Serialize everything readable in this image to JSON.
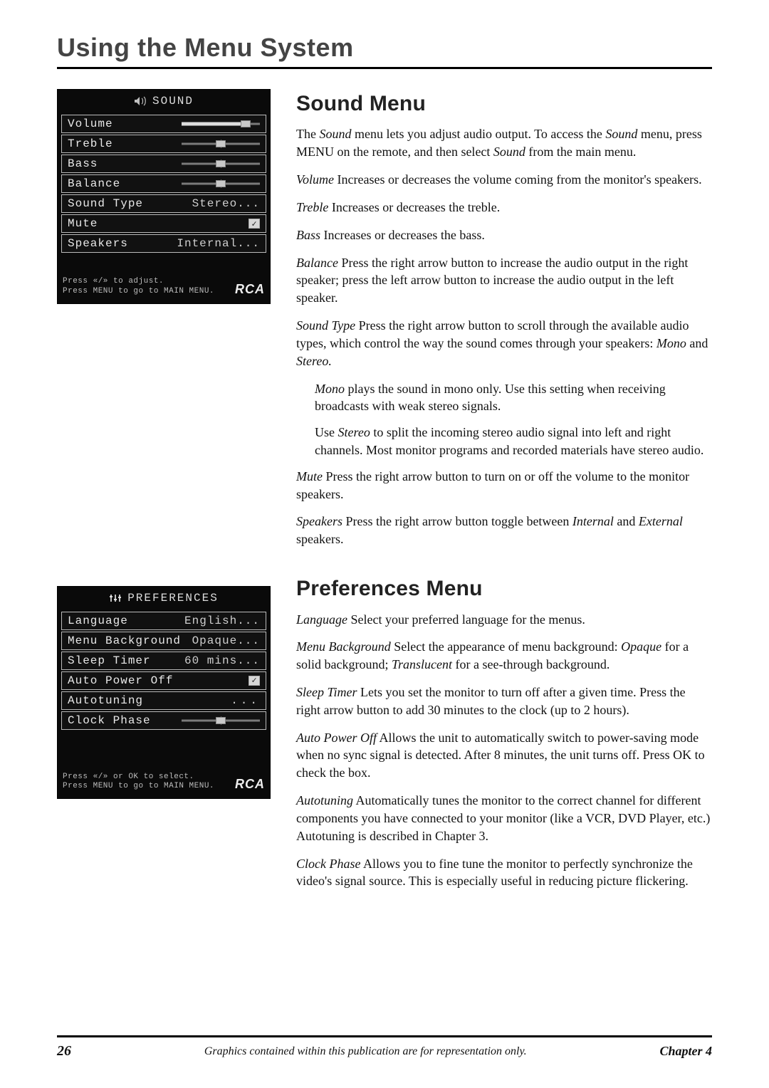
{
  "chapter_title": "Using the Menu System",
  "footer": {
    "page": "26",
    "center": "Graphics contained within this publication are for representation only.",
    "right": "Chapter 4"
  },
  "screens": {
    "sound": {
      "header": "SOUND",
      "items": {
        "volume_label": "Volume",
        "treble_label": "Treble",
        "bass_label": "Bass",
        "balance_label": "Balance",
        "sound_type_label": "Sound Type",
        "sound_type_value": "Stereo...",
        "mute_label": "Mute",
        "mute_checked": "✓",
        "speakers_label": "Speakers",
        "speakers_value": "Internal..."
      },
      "slider": {
        "volume_pct": 82,
        "treble_pct": 50,
        "bass_pct": 50,
        "balance_pct": 50,
        "clock_phase_pct": 50
      },
      "footer": "Press «/» to adjust.\nPress MENU to go to MAIN MENU.",
      "brand": "RCA"
    },
    "prefs": {
      "header": "PREFERENCES",
      "items": {
        "language_label": "Language",
        "language_value": "English...",
        "menu_bg_label": "Menu Background",
        "menu_bg_value": "Opaque...",
        "sleep_label": "Sleep Timer",
        "sleep_value": "60 mins...",
        "apo_label": "Auto Power Off",
        "apo_checked": "✓",
        "autotune_label": "Autotuning",
        "autotune_value": "...",
        "clock_label": "Clock Phase"
      },
      "footer": "Press «/» or OK to select.\nPress MENU to go to MAIN MENU.",
      "brand": "RCA"
    }
  },
  "sound_section": {
    "title": "Sound Menu",
    "intro_1": "The ",
    "intro_em1": "Sound",
    "intro_2": " menu lets you adjust audio output. To access the ",
    "intro_em2": "Sound",
    "intro_3": " menu, press MENU on the remote, and then select ",
    "intro_em3": "Sound",
    "intro_4": " from the main menu.",
    "volume_term": "Volume",
    "volume_desc": "   Increases or decreases the volume coming from the monitor's speakers.",
    "treble_term": "Treble",
    "treble_desc": "  Increases or decreases the treble.",
    "bass_term": "Bass",
    "bass_desc": "  Increases or decreases the bass.",
    "balance_term": "Balance",
    "balance_desc": "  Press the right arrow button to increase the audio output in the right speaker; press the left arrow button to increase the audio output in the left speaker.",
    "stype_term": "Sound Type",
    "stype_desc_a": "   Press the right arrow button to scroll through the available audio types, which control the way the sound comes through your speakers: ",
    "stype_em1": "Mono",
    "stype_and": " and ",
    "stype_em2": "Stereo.",
    "mono_em": "Mono",
    "mono_desc": " plays the sound in mono only. Use this setting when receiving broadcasts with weak stereo signals.",
    "stereo_pre": "Use ",
    "stereo_em": "Stereo",
    "stereo_desc": " to split the incoming stereo audio signal into left and right channels. Most monitor programs and recorded materials have stereo audio.",
    "mute_term": "Mute",
    "mute_desc": "   Press the right arrow button to turn on or off the volume to the monitor speakers.",
    "speakers_term": "Speakers",
    "speakers_desc_a": "   Press the right arrow button toggle between ",
    "speakers_em1": "Internal",
    "speakers_desc_b": " and ",
    "speakers_em2": "External",
    "speakers_desc_c": " speakers."
  },
  "prefs_section": {
    "title": "Preferences Menu",
    "lang_term": "Language",
    "lang_desc": "   Select your preferred language for the menus.",
    "mbg_term": "Menu Background",
    "mbg_desc_a": "   Select the appearance of menu background: ",
    "mbg_em1": "Opaque",
    "mbg_desc_b": " for a solid background; ",
    "mbg_em2": "Translucent",
    "mbg_desc_c": " for a see-through background.",
    "sleep_term": "Sleep Timer",
    "sleep_desc": "   Lets you set the monitor to turn off after a given time. Press the right arrow button to add 30 minutes to the clock (up to 2 hours).",
    "apo_term": "Auto Power Off",
    "apo_desc": "   Allows the unit to automatically switch to power-saving mode when no sync signal is detected. After 8 minutes, the unit turns off. Press OK to check the box.",
    "auto_term": "Autotuning",
    "auto_desc": "   Automatically tunes the monitor to the correct channel for different components you have connected to your monitor (like a VCR, DVD Player, etc.)  Autotuning is described in Chapter 3.",
    "clock_term": "Clock Phase",
    "clock_desc": "   Allows you to fine tune the monitor to perfectly synchronize the video's signal source. This is especially useful in reducing picture flickering."
  }
}
